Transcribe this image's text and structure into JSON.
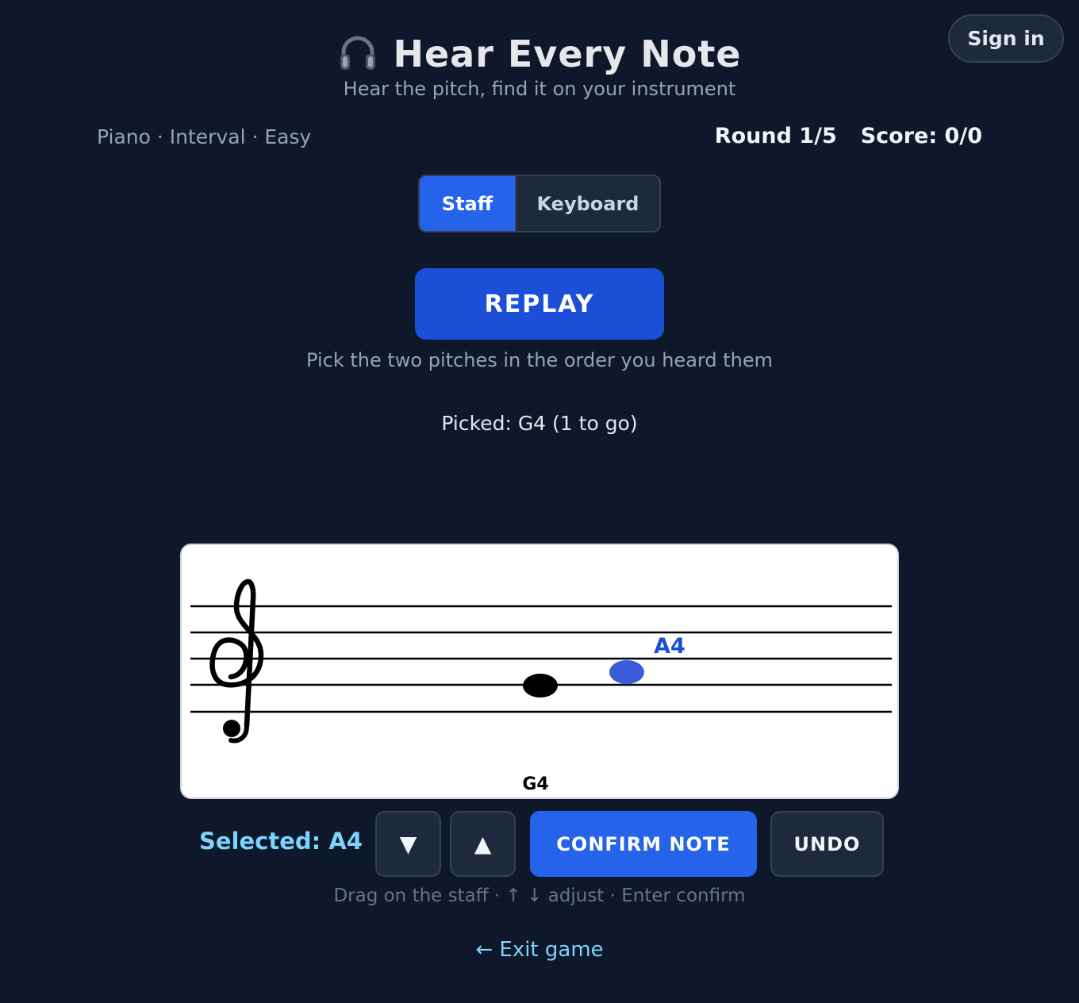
{
  "header": {
    "title": "Hear Every Note",
    "subtitle": "Hear the pitch, find it on your instrument",
    "icon": "headphones-icon",
    "signin_label": "Sign in"
  },
  "game": {
    "mode": "Piano · Interval · Easy",
    "round": "Round 1/5",
    "score": "Score: 0/0"
  },
  "view_toggle": {
    "options": [
      "Staff",
      "Keyboard"
    ],
    "selected": "Staff"
  },
  "replay_label": "REPLAY",
  "instruction": "Pick the two pitches in the order you heard them",
  "picked_status": "Picked: G4 (1 to go)",
  "staff": {
    "clef": "treble",
    "placed_note": {
      "label": "G4",
      "pitch": "G4"
    },
    "selected_note": {
      "label": "A4",
      "pitch": "A4"
    }
  },
  "controls": {
    "selected_label": "Selected: A4",
    "down_label": "▼",
    "up_label": "▲",
    "confirm_label": "CONFIRM NOTE",
    "undo_label": "UNDO"
  },
  "hint": "Drag on the staff · ↑ ↓ adjust · Enter confirm",
  "exit_label": "← Exit game",
  "colors": {
    "background": "#0f172a",
    "accent": "#2563eb",
    "selected_text": "#7dd3fc",
    "selected_note": "#3b5bdb",
    "placed_note": "#000000"
  }
}
